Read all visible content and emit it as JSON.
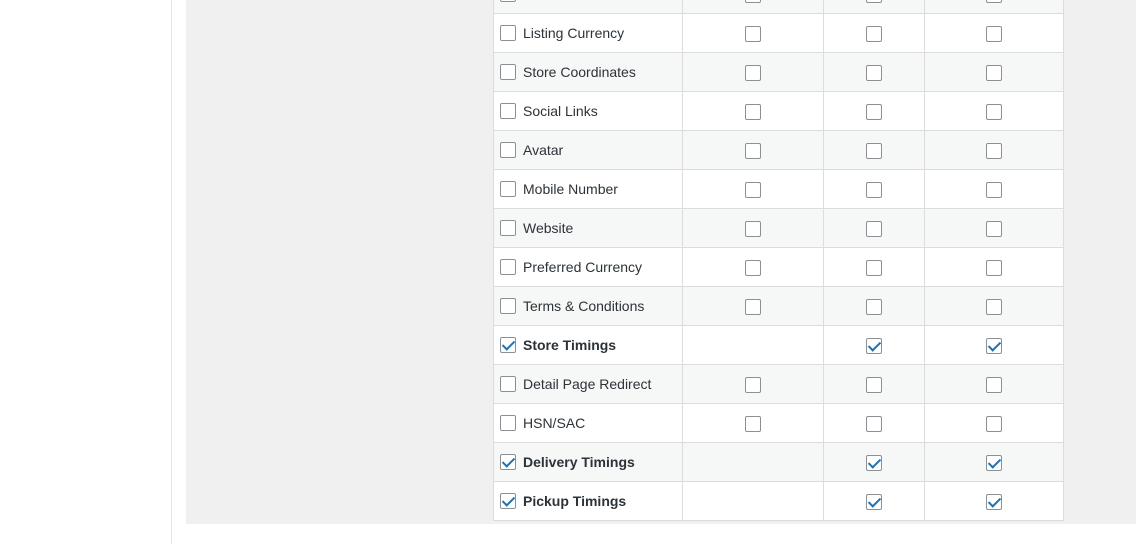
{
  "rows": [
    {
      "label": "",
      "checked": false,
      "col2": "unchecked",
      "col3": "unchecked",
      "col4": "unchecked"
    },
    {
      "label": "Listing Currency",
      "checked": false,
      "col2": "unchecked",
      "col3": "unchecked",
      "col4": "unchecked"
    },
    {
      "label": "Store Coordinates",
      "checked": false,
      "col2": "unchecked",
      "col3": "unchecked",
      "col4": "unchecked"
    },
    {
      "label": "Social Links",
      "checked": false,
      "col2": "unchecked",
      "col3": "unchecked",
      "col4": "unchecked"
    },
    {
      "label": "Avatar",
      "checked": false,
      "col2": "unchecked",
      "col3": "unchecked",
      "col4": "unchecked"
    },
    {
      "label": "Mobile Number",
      "checked": false,
      "col2": "unchecked",
      "col3": "unchecked",
      "col4": "unchecked"
    },
    {
      "label": "Website",
      "checked": false,
      "col2": "unchecked",
      "col3": "unchecked",
      "col4": "unchecked"
    },
    {
      "label": "Preferred Currency",
      "checked": false,
      "col2": "unchecked",
      "col3": "unchecked",
      "col4": "unchecked"
    },
    {
      "label": "Terms & Conditions",
      "checked": false,
      "col2": "unchecked",
      "col3": "unchecked",
      "col4": "unchecked"
    },
    {
      "label": "Store Timings",
      "checked": true,
      "col2": "none",
      "col3": "checked",
      "col4": "checked"
    },
    {
      "label": "Detail Page Redirect",
      "checked": false,
      "col2": "unchecked",
      "col3": "unchecked",
      "col4": "unchecked"
    },
    {
      "label": "HSN/SAC",
      "checked": false,
      "col2": "unchecked",
      "col3": "unchecked",
      "col4": "unchecked"
    },
    {
      "label": "Delivery Timings",
      "checked": true,
      "col2": "none",
      "col3": "checked",
      "col4": "checked"
    },
    {
      "label": "Pickup Timings",
      "checked": true,
      "col2": "none",
      "col3": "checked",
      "col4": "checked"
    }
  ],
  "colors": {
    "panel_bg": "#f0f0f1",
    "border": "#dcdcde",
    "check_accent": "#2271b1"
  }
}
